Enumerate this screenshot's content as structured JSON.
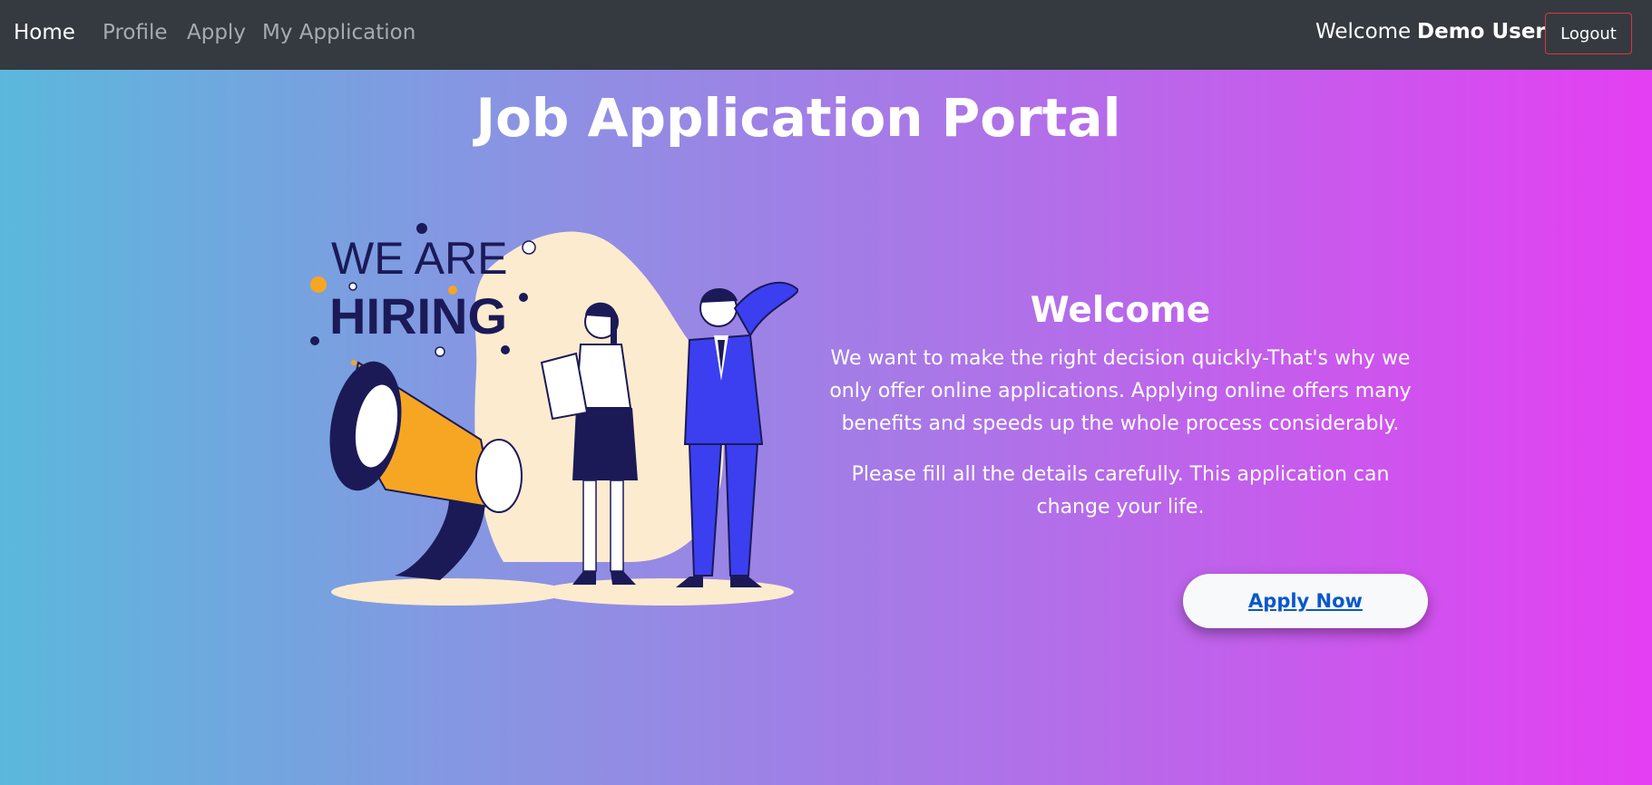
{
  "nav": {
    "brand": "Home",
    "links": [
      "Profile",
      "Apply",
      "My Application"
    ],
    "welcome": "Welcome",
    "user_name": "Demo User",
    "logout_label": "Logout"
  },
  "main": {
    "title": "Job Application Portal",
    "hero_text": [
      "WE ARE",
      "HIRING"
    ],
    "welcome_heading": "Welcome",
    "paragraph1": "We want to make the right decision quickly-That's why we only offer online applications. Applying online offers many benefits and speeds up the whole process considerably.",
    "paragraph2": "Please fill all the details carefully. This application can change your life.",
    "apply_label": "Apply Now"
  },
  "colors": {
    "navbar": "#343a40",
    "gradient_start": "#5bb8dc",
    "gradient_end": "#e43ff2",
    "link_blue": "#0a58ca"
  }
}
